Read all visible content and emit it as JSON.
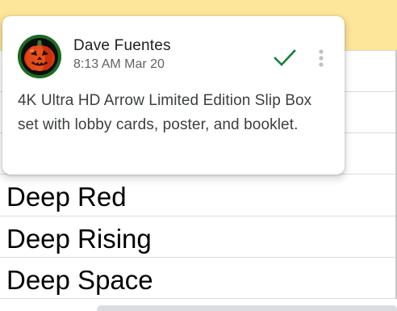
{
  "comment": {
    "author": "Dave Fuentes",
    "timestamp": "8:13 AM Mar 20",
    "body": "4K Ultra HD Arrow Limited Edition Slip Box set with lobby cards, poster, and booklet.",
    "avatar_icon": "jack-o-lantern-avatar",
    "resolve_icon": "checkmark-icon",
    "more_icon": "more-vert-icon"
  },
  "sheet": {
    "rows": [
      {
        "text": "Deep Red"
      },
      {
        "text": "Deep Rising"
      },
      {
        "text": "Deep Space"
      }
    ]
  },
  "colors": {
    "selected_band": "#fde69a",
    "resolve_check": "#188038",
    "avatar_bg": "#1e6a25",
    "pumpkin": "#d93a14"
  }
}
